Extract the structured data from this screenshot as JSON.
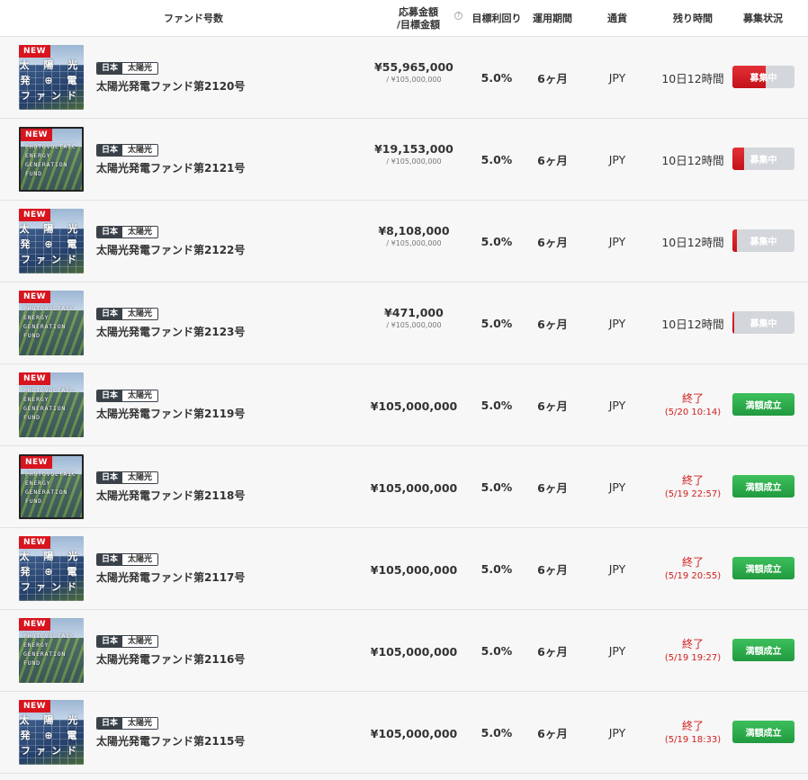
{
  "header": {
    "fund_col": "ファンド号数",
    "amount_col_line1": "応募金額",
    "amount_col_line2": "/目標金額",
    "help_icon": "?",
    "yield_col": "目標利回り",
    "period_col": "運用期間",
    "currency_col": "通貨",
    "remaining_col": "残り時間",
    "status_col": "募集状況"
  },
  "colors": {
    "new_badge": "#d8141e",
    "recruit": "#d3d6da",
    "recruit_fill": "#d8141e",
    "done": "#2fae4c",
    "ended_text": "#d11d1d"
  },
  "rows": [
    {
      "new": "NEW",
      "thumb_text": "太 陽 光\n発 ⊕ 電\nファンド",
      "thumb_style": "jp",
      "framed": false,
      "country": "日本",
      "type": "太陽光",
      "name": "太陽光発電ファンド第2120号",
      "applied": "¥55,965,000",
      "target": "/ ¥105,000,000",
      "yield": "5.0%",
      "period": "6ヶ月",
      "currency": "JPY",
      "remaining": "10日12時間",
      "ended": false,
      "status": "募集中",
      "progress": 0.533
    },
    {
      "new": "NEW",
      "thumb_text": "PHOTOVOLTAIC\nENERGY\nGENERATION\nFUND",
      "thumb_style": "en",
      "framed": true,
      "country": "日本",
      "type": "太陽光",
      "name": "太陽光発電ファンド第2121号",
      "applied": "¥19,153,000",
      "target": "/ ¥105,000,000",
      "yield": "5.0%",
      "period": "6ヶ月",
      "currency": "JPY",
      "remaining": "10日12時間",
      "ended": false,
      "status": "募集中",
      "progress": 0.182
    },
    {
      "new": "NEW",
      "thumb_text": "太 陽 光\n発 ⊕ 電\nファンド",
      "thumb_style": "jp",
      "framed": false,
      "country": "日本",
      "type": "太陽光",
      "name": "太陽光発電ファンド第2122号",
      "applied": "¥8,108,000",
      "target": "/ ¥105,000,000",
      "yield": "5.0%",
      "period": "6ヶ月",
      "currency": "JPY",
      "remaining": "10日12時間",
      "ended": false,
      "status": "募集中",
      "progress": 0.077
    },
    {
      "new": "NEW",
      "thumb_text": "PHOTOVOLTAIC\nENERGY\nGENERATION\nFUND",
      "thumb_style": "en",
      "framed": false,
      "country": "日本",
      "type": "太陽光",
      "name": "太陽光発電ファンド第2123号",
      "applied": "¥471,000",
      "target": "/ ¥105,000,000",
      "yield": "5.0%",
      "period": "6ヶ月",
      "currency": "JPY",
      "remaining": "10日12時間",
      "ended": false,
      "status": "募集中",
      "progress": 0.004
    },
    {
      "new": "NEW",
      "thumb_text": "PHOTOVOLTAIC\nENERGY\nGENERATION\nFUND",
      "thumb_style": "en",
      "framed": false,
      "country": "日本",
      "type": "太陽光",
      "name": "太陽光発電ファンド第2119号",
      "applied": "¥105,000,000",
      "target": "",
      "yield": "5.0%",
      "period": "6ヶ月",
      "currency": "JPY",
      "remaining": "終了",
      "ended_date": "(5/20 10:14)",
      "ended": true,
      "status": "満額成立",
      "progress": 1
    },
    {
      "new": "NEW",
      "thumb_text": "PHOTOVOLTAIC\nENERGY\nGENERATION\nFUND",
      "thumb_style": "en",
      "framed": true,
      "country": "日本",
      "type": "太陽光",
      "name": "太陽光発電ファンド第2118号",
      "applied": "¥105,000,000",
      "target": "",
      "yield": "5.0%",
      "period": "6ヶ月",
      "currency": "JPY",
      "remaining": "終了",
      "ended_date": "(5/19 22:57)",
      "ended": true,
      "status": "満額成立",
      "progress": 1
    },
    {
      "new": "NEW",
      "thumb_text": "太 陽 光\n発 ⊕ 電\nファンド",
      "thumb_style": "jp",
      "framed": false,
      "country": "日本",
      "type": "太陽光",
      "name": "太陽光発電ファンド第2117号",
      "applied": "¥105,000,000",
      "target": "",
      "yield": "5.0%",
      "period": "6ヶ月",
      "currency": "JPY",
      "remaining": "終了",
      "ended_date": "(5/19 20:55)",
      "ended": true,
      "status": "満額成立",
      "progress": 1
    },
    {
      "new": "NEW",
      "thumb_text": "PHOTOVOLTAIC\nENERGY\nGENERATION\nFUND",
      "thumb_style": "en",
      "framed": false,
      "country": "日本",
      "type": "太陽光",
      "name": "太陽光発電ファンド第2116号",
      "applied": "¥105,000,000",
      "target": "",
      "yield": "5.0%",
      "period": "6ヶ月",
      "currency": "JPY",
      "remaining": "終了",
      "ended_date": "(5/19 19:27)",
      "ended": true,
      "status": "満額成立",
      "progress": 1
    },
    {
      "new": "NEW",
      "thumb_text": "太 陽 光\n発 ⊕ 電\nファンド",
      "thumb_style": "jp",
      "framed": false,
      "country": "日本",
      "type": "太陽光",
      "name": "太陽光発電ファンド第2115号",
      "applied": "¥105,000,000",
      "target": "",
      "yield": "5.0%",
      "period": "6ヶ月",
      "currency": "JPY",
      "remaining": "終了",
      "ended_date": "(5/19 18:33)",
      "ended": true,
      "status": "満額成立",
      "progress": 1
    }
  ]
}
